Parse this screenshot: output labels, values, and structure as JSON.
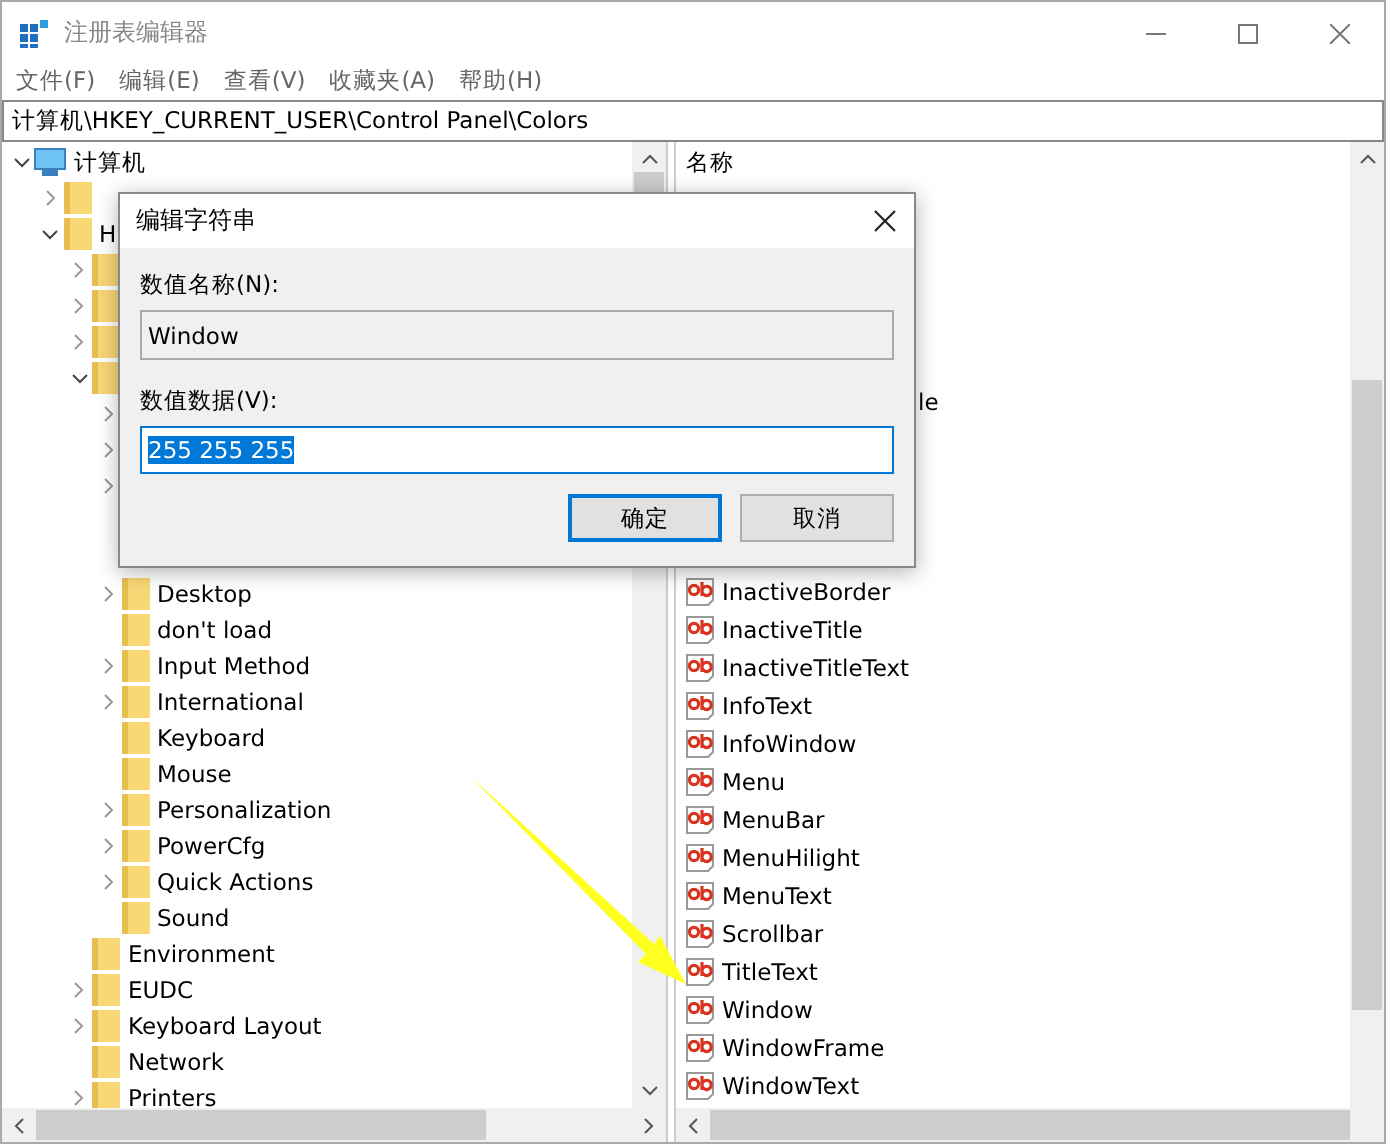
{
  "window": {
    "title": "注册表编辑器"
  },
  "menu": [
    "文件(F)",
    "编辑(E)",
    "查看(V)",
    "收藏夹(A)",
    "帮助(H)"
  ],
  "address": "计算机\\HKEY_CURRENT_USER\\Control Panel\\Colors",
  "tree": [
    {
      "label": "计算机",
      "kind": "computer",
      "leaf": false,
      "expanded": true,
      "children": [
        {
          "kind": "folder",
          "leaf": false,
          "expanded": false
        },
        {
          "label": "H",
          "kind": "folder",
          "leaf": false,
          "expanded": true,
          "children": [
            {
              "kind": "folder",
              "leaf": false,
              "expanded": false
            },
            {
              "kind": "folder",
              "leaf": false,
              "expanded": false
            },
            {
              "kind": "folder",
              "leaf": false,
              "expanded": false
            },
            {
              "kind": "folder",
              "leaf": false,
              "expanded": true,
              "children": [
                {
                  "kind": "covered",
                  "leaf": false,
                  "expanded": false
                },
                {
                  "kind": "covered",
                  "leaf": false,
                  "expanded": false
                },
                {
                  "kind": "covered",
                  "leaf": false,
                  "expanded": false
                },
                {
                  "kind": "covered",
                  "leaf": true
                },
                {
                  "kind": "covered",
                  "leaf": true
                },
                {
                  "label": "Desktop",
                  "kind": "folder",
                  "leaf": false,
                  "expanded": false
                },
                {
                  "label": "don't load",
                  "kind": "folder",
                  "leaf": true
                },
                {
                  "label": "Input Method",
                  "kind": "folder",
                  "leaf": false,
                  "expanded": false
                },
                {
                  "label": "International",
                  "kind": "folder",
                  "leaf": false,
                  "expanded": false
                },
                {
                  "label": "Keyboard",
                  "kind": "folder",
                  "leaf": true
                },
                {
                  "label": "Mouse",
                  "kind": "folder",
                  "leaf": true
                },
                {
                  "label": "Personalization",
                  "kind": "folder",
                  "leaf": false,
                  "expanded": false
                },
                {
                  "label": "PowerCfg",
                  "kind": "folder",
                  "leaf": false,
                  "expanded": false
                },
                {
                  "label": "Quick Actions",
                  "kind": "folder",
                  "leaf": false,
                  "expanded": false
                },
                {
                  "label": "Sound",
                  "kind": "folder",
                  "leaf": true
                }
              ]
            },
            {
              "label": "Environment",
              "kind": "folder",
              "leaf": true
            },
            {
              "label": "EUDC",
              "kind": "folder",
              "leaf": false,
              "expanded": false
            },
            {
              "label": "Keyboard Layout",
              "kind": "folder",
              "leaf": false,
              "expanded": false
            },
            {
              "label": "Network",
              "kind": "folder",
              "leaf": true
            },
            {
              "label": "Printers",
              "kind": "folder",
              "leaf": false,
              "expanded": false
            }
          ]
        }
      ]
    }
  ],
  "values": {
    "column": "名称",
    "items": [
      {
        "name": "le",
        "kind": "covered"
      },
      {
        "name": "InactiveBorder",
        "kind": "string"
      },
      {
        "name": "InactiveTitle",
        "kind": "string"
      },
      {
        "name": "InactiveTitleText",
        "kind": "string"
      },
      {
        "name": "InfoText",
        "kind": "string"
      },
      {
        "name": "InfoWindow",
        "kind": "string"
      },
      {
        "name": "Menu",
        "kind": "string"
      },
      {
        "name": "MenuBar",
        "kind": "string"
      },
      {
        "name": "MenuHilight",
        "kind": "string"
      },
      {
        "name": "MenuText",
        "kind": "string"
      },
      {
        "name": "Scrollbar",
        "kind": "string"
      },
      {
        "name": "TitleText",
        "kind": "string"
      },
      {
        "name": "Window",
        "kind": "string"
      },
      {
        "name": "WindowFrame",
        "kind": "string"
      },
      {
        "name": "WindowText",
        "kind": "string"
      }
    ]
  },
  "dialog": {
    "title": "编辑字符串",
    "name_label": "数值名称(N):",
    "name_value": "Window",
    "data_label": "数值数据(V):",
    "data_value": "255 255 255",
    "data_selected": true,
    "buttons": [
      {
        "label": "确定",
        "default": true
      },
      {
        "label": "取消",
        "default": false
      }
    ]
  },
  "annotation": {
    "kind": "arrow"
  }
}
